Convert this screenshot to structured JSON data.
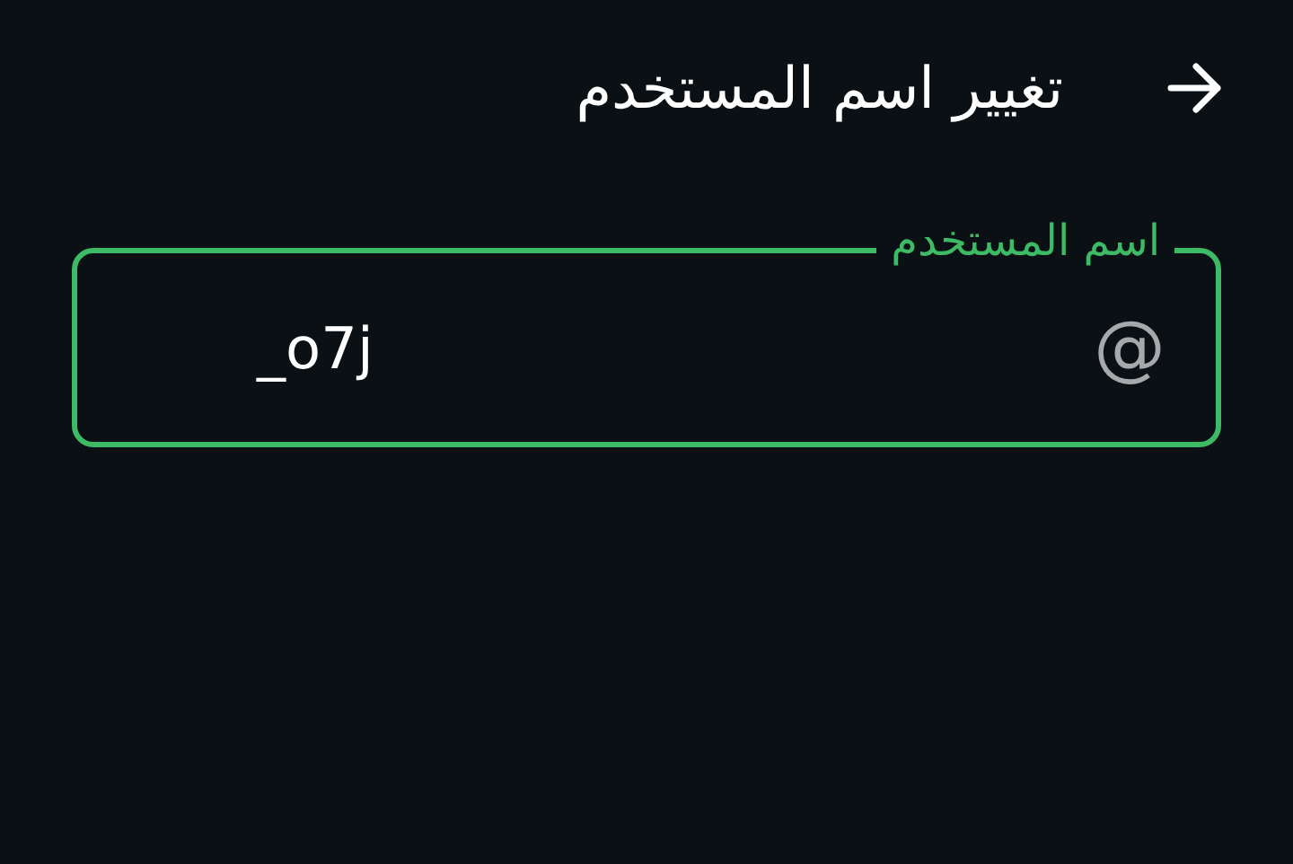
{
  "header": {
    "title": "تغيير اسم المستخدم"
  },
  "username_field": {
    "label": "اسم المستخدم",
    "prefix": "@",
    "value": "_o7j",
    "focused": true
  }
}
